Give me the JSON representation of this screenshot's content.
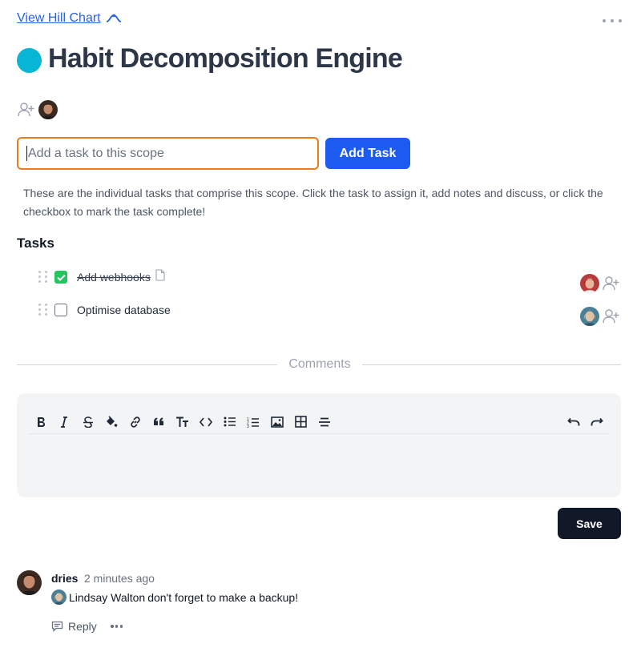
{
  "header": {
    "hill_link_label": "View Hill Chart",
    "title": "Habit Decomposition Engine",
    "scope_color": "#06b6d4"
  },
  "task_input": {
    "placeholder": "Add a task to this scope",
    "value": "",
    "button_label": "Add Task"
  },
  "helper_text": "These are the individual tasks that comprise this scope. Click the task to assign it, add notes and discuss, or click the checkbox to mark the task complete!",
  "tasks": {
    "heading": "Tasks",
    "items": [
      {
        "label": "Add webhooks",
        "completed": true,
        "has_note_icon": true,
        "assignee_icon": "avatar-woman-red"
      },
      {
        "label": "Optimise database",
        "completed": false,
        "has_note_icon": false,
        "assignee_icon": "avatar-woman-blue"
      }
    ]
  },
  "comments": {
    "divider_label": "Comments",
    "toolbar_icons": [
      "bold-icon",
      "italic-icon",
      "strikethrough-icon",
      "highlight-icon",
      "link-icon",
      "quote-icon",
      "text-size-icon",
      "code-icon",
      "bullet-list-icon",
      "numbered-list-icon",
      "image-icon",
      "table-icon",
      "horizontal-rule-icon",
      "undo-icon",
      "redo-icon"
    ],
    "save_label": "Save",
    "items": [
      {
        "author": "dries",
        "time": "2 minutes ago",
        "mention": "Lindsay Walton",
        "text": "don't forget to make a backup!",
        "reply_label": "Reply"
      }
    ]
  },
  "colors": {
    "primary": "#1d5bf0",
    "input_focus": "#ea7c1c",
    "check_green": "#22c55e",
    "save_dark": "#111827"
  }
}
